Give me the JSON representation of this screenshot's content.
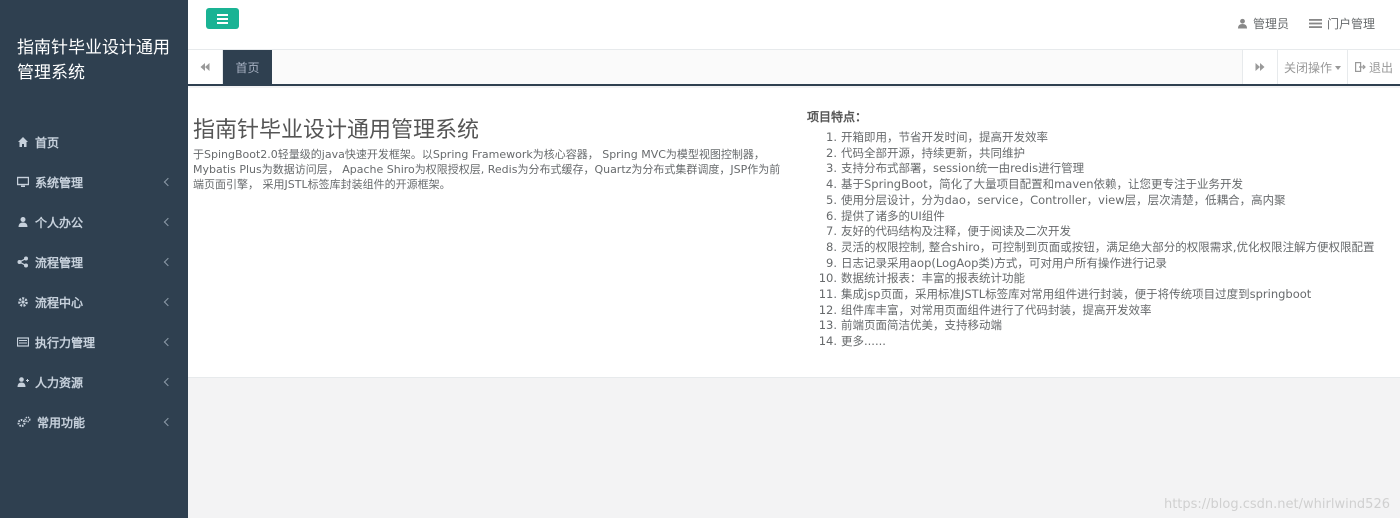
{
  "sidebar": {
    "brand": "指南针毕业设计通用管理系统",
    "items": [
      {
        "label": "首页",
        "icon": "home-icon",
        "has_arrow": false
      },
      {
        "label": "系统管理",
        "icon": "desktop-icon",
        "has_arrow": true
      },
      {
        "label": "个人办公",
        "icon": "user-icon",
        "has_arrow": true
      },
      {
        "label": "流程管理",
        "icon": "share-icon",
        "has_arrow": true
      },
      {
        "label": "流程中心",
        "icon": "gear-icon",
        "has_arrow": true
      },
      {
        "label": "执行力管理",
        "icon": "list-icon",
        "has_arrow": true
      },
      {
        "label": "人力资源",
        "icon": "user-plus-icon",
        "has_arrow": true
      },
      {
        "label": "常用功能",
        "icon": "gears-icon",
        "has_arrow": true
      }
    ]
  },
  "topbar": {
    "admin_label": "管理员",
    "portal_label": "门户管理"
  },
  "tabs": {
    "home_label": "首页",
    "close_ops_label": "关闭操作",
    "logout_label": "退出"
  },
  "main": {
    "title": "指南针毕业设计通用管理系统",
    "description": "于SpingBoot2.0轻量级的java快速开发框架。以Spring Framework为核心容器， Spring MVC为模型视图控制器， Mybatis Plus为数据访问层， Apache Shiro为权限授权层, Redis为分布式缓存，Quartz为分布式集群调度，JSP作为前端页面引擎， 采用JSTL标签库封装组件的开源框架。",
    "features_title": "项目特点：",
    "features": [
      {
        "num": "1.",
        "text": "开箱即用，节省开发时间，提高开发效率"
      },
      {
        "num": "2.",
        "text": "代码全部开源，持续更新，共同维护"
      },
      {
        "num": "3.",
        "text": "支持分布式部署，session统一由redis进行管理"
      },
      {
        "num": "4.",
        "text": "基于SpringBoot，简化了大量项目配置和maven依赖，让您更专注于业务开发"
      },
      {
        "num": "5.",
        "text": "使用分层设计，分为dao，service，Controller，view层，层次清楚，低耦合，高内聚"
      },
      {
        "num": "6.",
        "text": "提供了诸多的UI组件"
      },
      {
        "num": "7.",
        "text": "友好的代码结构及注释，便于阅读及二次开发"
      },
      {
        "num": "8.",
        "text": "灵活的权限控制, 整合shiro，可控制到页面或按钮，满足绝大部分的权限需求,优化权限注解方便权限配置"
      },
      {
        "num": "9.",
        "text": "日志记录采用aop(LogAop类)方式，可对用户所有操作进行记录"
      },
      {
        "num": "10.",
        "text": "数据统计报表：丰富的报表统计功能"
      },
      {
        "num": "11.",
        "text": "集成jsp页面，采用标准JSTL标签库对常用组件进行封装，便于将传统项目过度到springboot"
      },
      {
        "num": "12.",
        "text": "组件库丰富，对常用页面组件进行了代码封装，提高开发效率"
      },
      {
        "num": "13.",
        "text": "前端页面简洁优美，支持移动端"
      },
      {
        "num": "14.",
        "text": "更多......"
      }
    ]
  },
  "watermark": "https://blog.csdn.net/whirlwind526",
  "colors": {
    "sidebar_bg": "#2f4050",
    "accent": "#1ab394",
    "content_bg": "#ffffff",
    "page_bg": "#f3f3f4"
  }
}
